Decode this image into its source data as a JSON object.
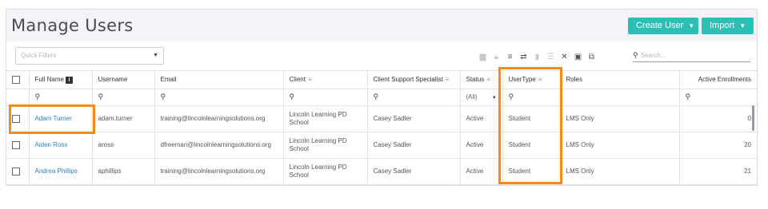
{
  "page": {
    "title": "Manage Users",
    "create_button": "Create User",
    "import_button": "Import"
  },
  "toolbar": {
    "quick_filters_placeholder": "Quick Filters",
    "search_placeholder": "Search...",
    "icons": [
      "report-icon",
      "lock-icon",
      "filter-icon",
      "swap-icon",
      "trash-icon",
      "list-icon",
      "expand-icon",
      "export-icon",
      "column-settings-icon"
    ]
  },
  "table": {
    "columns": [
      "Full Name",
      "Username",
      "Email",
      "Client",
      "Client Support Specialist",
      "Status",
      "UserType",
      "Roles",
      "Active Enrollments"
    ],
    "status_filter": "(All)",
    "rows": [
      {
        "full_name": "Adam Turner",
        "username": "adam.turner",
        "email": "training@lincolnlearningsolutions.org",
        "client": "Lincoln Learning PD School",
        "specialist": "Casey Sadler",
        "status": "Active",
        "user_type": "Student",
        "roles": "LMS Only",
        "enrollments": "0"
      },
      {
        "full_name": "Aiden Ross",
        "username": "aross",
        "email": "dfreeman@lincolnlearningsolutions.org",
        "client": "Lincoln Learning PD School",
        "specialist": "Casey Sadler",
        "status": "Active",
        "user_type": "Student",
        "roles": "LMS Only",
        "enrollments": "20"
      },
      {
        "full_name": "Andrea Phillips",
        "username": "aphillips",
        "email": "training@lincolnlearningsolutions.org",
        "client": "Lincoln Learning PD School",
        "specialist": "Casey Sadler",
        "status": "Active",
        "user_type": "Student",
        "roles": "LMS Only",
        "enrollments": "21"
      }
    ]
  },
  "colors": {
    "accent": "#2bbfb6",
    "highlight": "#f28c1c",
    "link": "#2d7fc0"
  }
}
